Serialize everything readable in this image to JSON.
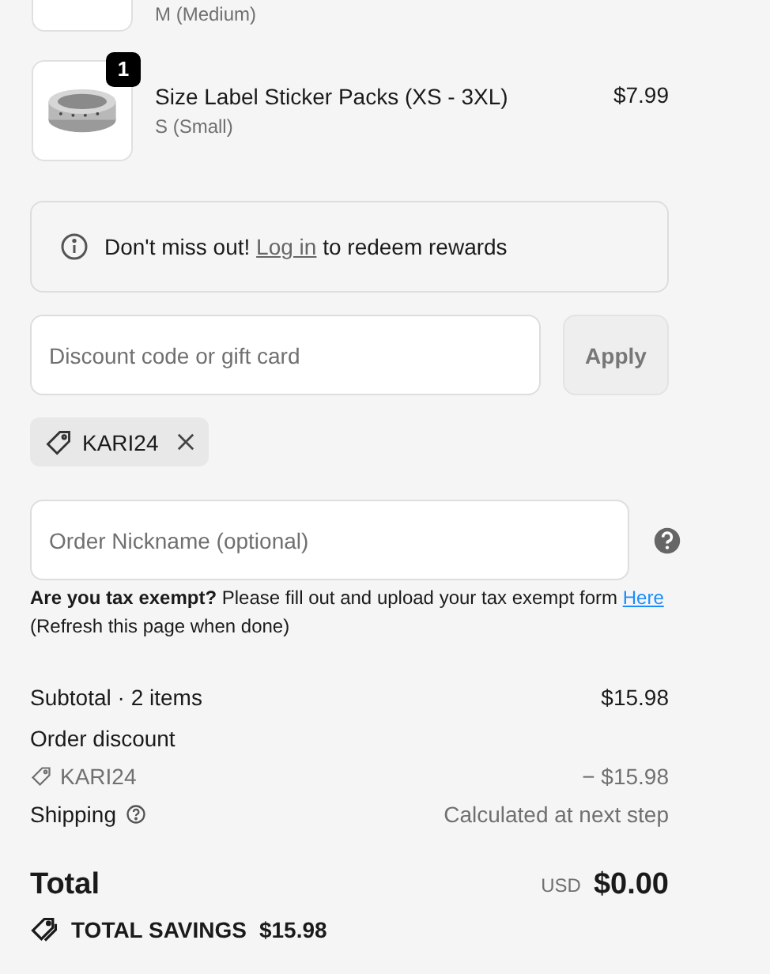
{
  "cart_items": [
    {
      "kind": "cut",
      "variant": "M (Medium)"
    },
    {
      "kind": "full",
      "name": "Size Label Sticker Packs (XS - 3XL)",
      "variant": "S (Small)",
      "price": "$7.99",
      "quantity": "1"
    }
  ],
  "rewards_notice": {
    "before": "Don't miss out!",
    "link": "Log in",
    "after": "to redeem rewards"
  },
  "discount": {
    "placeholder": "Discount code or gift card",
    "apply_label": "Apply",
    "applied_codes": [
      "KARI24"
    ]
  },
  "order_nickname": {
    "placeholder": "Order Nickname (optional)"
  },
  "tax_notice": {
    "text": "**Are you tax exempt?** Please fill out and upload your tax exempt form",
    "link": "Here",
    "note": "(Refresh this page when done)"
  },
  "summary": {
    "rows": [
      {
        "kind": "line",
        "label": "Subtotal · 2 items",
        "value": "$15.98"
      },
      {
        "kind": "heading",
        "label": "Order discount"
      },
      {
        "kind": "code",
        "label": "KARI24",
        "value": "− $15.98"
      },
      {
        "kind": "help",
        "label": "Shipping",
        "value": "Calculated at next step"
      }
    ],
    "total_label": "Total",
    "currency": "USD",
    "total": "$0.00",
    "savings_label": "TOTAL SAVINGS",
    "savings": "$15.98"
  }
}
